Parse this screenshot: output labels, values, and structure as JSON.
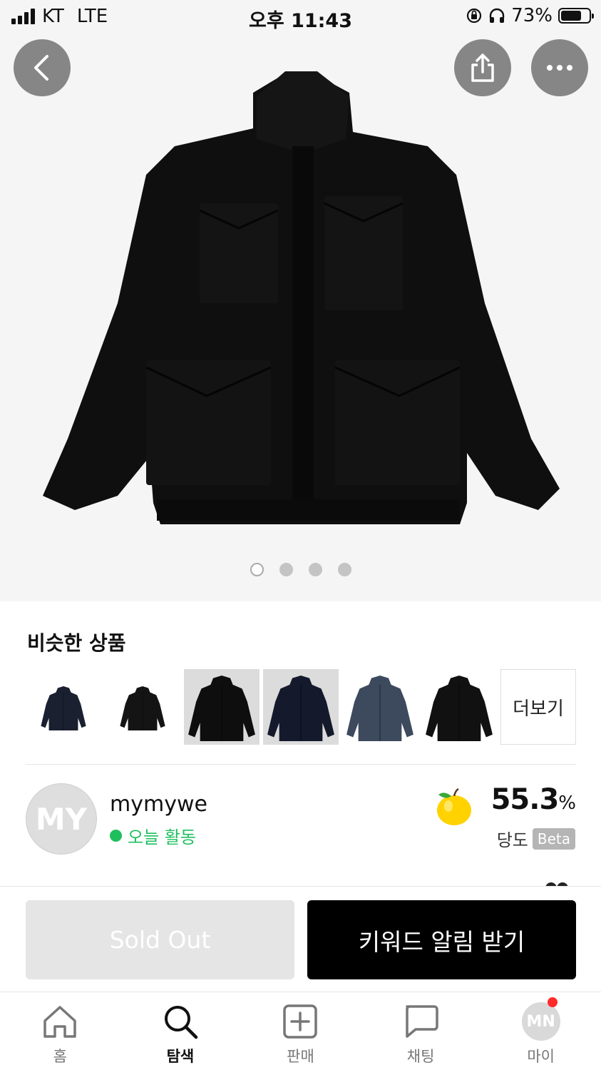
{
  "status_bar": {
    "carrier": "KT",
    "network": "LTE",
    "time": "오후 11:43",
    "battery": "73%",
    "battery_level": 0.73
  },
  "hero": {
    "image_count": 4,
    "active_index": 0,
    "buttons": {
      "back": "back-icon",
      "share": "share-icon",
      "more": "more-icon"
    }
  },
  "similar": {
    "title": "비슷한 상품",
    "more_label": "더보기",
    "items": [
      {
        "color": "#1a2030",
        "bg": "#ffffff"
      },
      {
        "color": "#141414",
        "bg": "#ffffff"
      },
      {
        "color": "#0e0e0e",
        "bg": "#dcdcdc"
      },
      {
        "color": "#141a2c",
        "bg": "#dcdcdc"
      },
      {
        "color": "#3d4a5e",
        "bg": "#ffffff"
      },
      {
        "color": "#111111",
        "bg": "#ffffff"
      }
    ]
  },
  "seller": {
    "avatar_initials": "MY",
    "name": "mymywe",
    "status": "오늘 활동",
    "sweetness_value": "55.3",
    "sweetness_unit": "%",
    "sweetness_label": "당도",
    "beta_label": "Beta"
  },
  "actions": {
    "sold_out": "Sold Out",
    "keyword_alert": "키워드 알림 받기"
  },
  "tabs": [
    {
      "label": "홈",
      "icon": "home-icon"
    },
    {
      "label": "탐색",
      "icon": "search-icon",
      "active": true
    },
    {
      "label": "판매",
      "icon": "add-icon"
    },
    {
      "label": "채팅",
      "icon": "chat-icon"
    },
    {
      "label": "마이",
      "icon": "profile-avatar",
      "avatar_initials": "MN",
      "notification": true
    }
  ],
  "colors": {
    "accent_green": "#1fbf5e",
    "notification_red": "#ff2a2a",
    "primary_button": "#000000"
  }
}
